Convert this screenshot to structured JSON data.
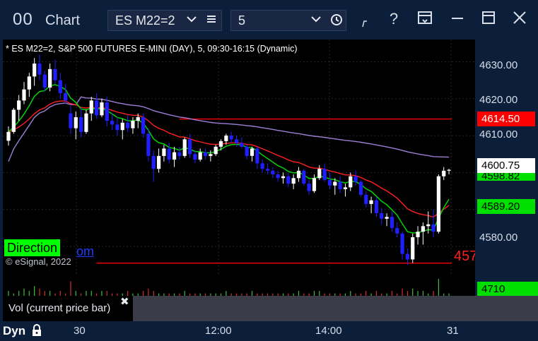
{
  "window": {
    "title_icon": "00",
    "title": "Chart",
    "symbol": "ES M22=2",
    "interval": "5",
    "icons": [
      "chevron-down-icon",
      "menu-icon",
      "chevron-down-icon",
      "clock-icon",
      "draw-icon",
      "help-icon",
      "save-icon",
      "minimize-icon",
      "maximize-icon",
      "close-icon"
    ]
  },
  "chart": {
    "header": "* ES M22=2, S&P 500 FUTURES E-MINI (DAY), 5, 09:30-16:15 (Dynamic)",
    "direction_label": "Direction",
    "partial_text": "om",
    "copyright": "© eSignal, 2022",
    "level_cut_label": "457",
    "price_ticks": [
      "4630.00",
      "4620.00",
      "4610.00",
      "4580.00"
    ],
    "badges": [
      {
        "text": "4614.50",
        "price": 4614.5,
        "bg": "#ff0000",
        "fg": "#ffffff"
      },
      {
        "text": "4600.75",
        "price": 4600.75,
        "bg": "#ffffff",
        "fg": "#000000"
      },
      {
        "text": "4598.82",
        "price": 4598.3,
        "bg": "#00e000",
        "fg": "#000000"
      },
      {
        "text": "4589.20",
        "price": 4589.2,
        "bg": "#00e000",
        "fg": "#000000"
      }
    ],
    "colors": {
      "up": "#ffffff",
      "down": "#1f1fff",
      "fast_ma": "#00e000",
      "slow_ma": "#ff2020",
      "vwap": "#9c7fd6",
      "level": "#ff0000",
      "grid": "#262626"
    }
  },
  "chart_data": {
    "type": "candlestick",
    "x_ticks": [
      "30",
      "12:00",
      "14:00",
      "31"
    ],
    "ylim": [
      4572,
      4636
    ],
    "levels": [
      4614.5,
      4575.5
    ],
    "ohlc": [
      [
        4608.6,
        4612.5,
        4607.3,
        4611.0
      ],
      [
        4611.0,
        4617.5,
        4610.5,
        4617.0
      ],
      [
        4617.0,
        4621.0,
        4614.0,
        4619.5
      ],
      [
        4619.5,
        4624.5,
        4618.5,
        4622.5
      ],
      [
        4622.5,
        4627.0,
        4620.5,
        4626.0
      ],
      [
        4626.0,
        4631.0,
        4623.5,
        4629.5
      ],
      [
        4629.5,
        4632.0,
        4625.0,
        4626.5
      ],
      [
        4626.5,
        4627.5,
        4622.0,
        4623.0
      ],
      [
        4623.0,
        4629.5,
        4622.0,
        4628.0
      ],
      [
        4628.0,
        4630.5,
        4624.0,
        4625.0
      ],
      [
        4625.0,
        4627.0,
        4620.0,
        4621.5
      ],
      [
        4621.5,
        4624.0,
        4618.5,
        4619.5
      ],
      [
        4616.0,
        4618.0,
        4610.5,
        4612.0
      ],
      [
        4612.0,
        4616.5,
        4609.0,
        4615.0
      ],
      [
        4615.0,
        4617.5,
        4609.5,
        4611.0
      ],
      [
        4611.0,
        4617.0,
        4610.5,
        4616.0
      ],
      [
        4616.0,
        4620.5,
        4614.0,
        4619.5
      ],
      [
        4619.5,
        4621.5,
        4614.5,
        4615.5
      ],
      [
        4615.5,
        4620.0,
        4615.0,
        4619.0
      ],
      [
        4619.0,
        4620.5,
        4612.5,
        4614.0
      ],
      [
        4614.0,
        4616.0,
        4611.5,
        4613.0
      ],
      [
        4613.0,
        4615.0,
        4610.0,
        4611.5
      ],
      [
        4611.5,
        4614.5,
        4609.0,
        4613.5
      ],
      [
        4613.5,
        4615.5,
        4611.0,
        4612.0
      ],
      [
        4612.0,
        4615.0,
        4610.5,
        4614.0
      ],
      [
        4614.0,
        4616.0,
        4612.0,
        4615.0
      ],
      [
        4615.0,
        4616.0,
        4609.5,
        4610.5
      ],
      [
        4610.5,
        4612.0,
        4603.0,
        4604.5
      ],
      [
        4604.5,
        4606.0,
        4597.5,
        4601.0
      ],
      [
        4601.0,
        4606.5,
        4600.0,
        4604.5
      ],
      [
        4604.5,
        4607.5,
        4603.0,
        4606.5
      ],
      [
        4606.5,
        4608.0,
        4602.5,
        4603.5
      ],
      [
        4603.5,
        4607.0,
        4601.5,
        4605.5
      ],
      [
        4605.5,
        4607.0,
        4603.5,
        4604.5
      ],
      [
        4604.5,
        4609.5,
        4604.0,
        4609.0
      ],
      [
        4609.0,
        4610.5,
        4604.0,
        4605.0
      ],
      [
        4605.0,
        4606.0,
        4602.5,
        4603.5
      ],
      [
        4603.5,
        4606.5,
        4603.0,
        4605.5
      ],
      [
        4605.5,
        4606.5,
        4603.5,
        4604.5
      ],
      [
        4604.5,
        4606.0,
        4603.0,
        4605.0
      ],
      [
        4605.0,
        4607.5,
        4604.5,
        4607.0
      ],
      [
        4607.0,
        4609.0,
        4606.0,
        4608.5
      ],
      [
        4608.5,
        4610.5,
        4607.5,
        4610.0
      ],
      [
        4610.0,
        4611.0,
        4608.0,
        4609.0
      ],
      [
        4609.0,
        4610.0,
        4607.0,
        4608.0
      ],
      [
        4608.0,
        4609.5,
        4606.5,
        4607.0
      ],
      [
        4607.0,
        4607.5,
        4603.5,
        4604.5
      ],
      [
        4604.5,
        4607.0,
        4603.0,
        4606.5
      ],
      [
        4606.5,
        4607.0,
        4601.0,
        4602.5
      ],
      [
        4602.5,
        4603.5,
        4600.0,
        4601.0
      ],
      [
        4601.0,
        4602.5,
        4599.5,
        4600.5
      ],
      [
        4600.5,
        4601.5,
        4598.5,
        4599.5
      ],
      [
        4599.5,
        4600.5,
        4597.5,
        4598.5
      ],
      [
        4598.5,
        4600.0,
        4597.0,
        4599.0
      ],
      [
        4599.0,
        4600.0,
        4596.0,
        4597.0
      ],
      [
        4597.0,
        4599.5,
        4595.5,
        4598.5
      ],
      [
        4598.5,
        4601.5,
        4597.5,
        4600.5
      ],
      [
        4600.5,
        4601.0,
        4596.5,
        4597.0
      ],
      [
        4597.0,
        4598.0,
        4594.0,
        4595.0
      ],
      [
        4595.0,
        4599.5,
        4594.5,
        4598.5
      ],
      [
        4598.5,
        4602.0,
        4598.0,
        4601.0
      ],
      [
        4601.0,
        4602.5,
        4597.5,
        4598.0
      ],
      [
        4598.0,
        4600.0,
        4595.5,
        4596.5
      ],
      [
        4596.5,
        4598.5,
        4594.0,
        4597.5
      ],
      [
        4597.5,
        4599.0,
        4594.5,
        4595.5
      ],
      [
        4595.5,
        4597.0,
        4593.5,
        4596.0
      ],
      [
        4596.0,
        4600.0,
        4595.0,
        4599.0
      ],
      [
        4599.0,
        4600.5,
        4596.5,
        4597.5
      ],
      [
        4597.5,
        4598.0,
        4593.5,
        4594.0
      ],
      [
        4594.0,
        4595.0,
        4590.5,
        4591.5
      ],
      [
        4591.5,
        4593.5,
        4589.0,
        4592.5
      ],
      [
        4592.5,
        4593.5,
        4588.0,
        4589.0
      ],
      [
        4589.0,
        4590.5,
        4586.0,
        4587.5
      ],
      [
        4587.5,
        4589.0,
        4585.5,
        4588.0
      ],
      [
        4588.0,
        4589.5,
        4584.0,
        4585.0
      ],
      [
        4585.0,
        4586.5,
        4582.5,
        4583.5
      ],
      [
        4583.5,
        4584.0,
        4576.5,
        4578.0
      ],
      [
        4578.0,
        4579.5,
        4575.0,
        4576.5
      ],
      [
        4576.5,
        4583.5,
        4575.5,
        4582.5
      ],
      [
        4582.5,
        4585.5,
        4580.5,
        4584.0
      ],
      [
        4584.0,
        4586.5,
        4580.5,
        4585.5
      ],
      [
        4585.5,
        4589.5,
        4583.5,
        4586.0
      ],
      [
        4586.0,
        4590.0,
        4582.5,
        4584.0
      ],
      [
        4584.0,
        4599.5,
        4583.5,
        4599.0
      ],
      [
        4599.0,
        4601.5,
        4598.0,
        4600.5
      ],
      [
        4600.5,
        4601.0,
        4599.5,
        4600.75
      ]
    ],
    "volume": [
      2,
      1,
      2,
      3,
      2,
      4,
      3,
      2,
      2,
      1,
      2,
      1,
      6,
      2,
      1,
      2,
      2,
      1,
      2,
      2,
      1,
      1,
      1,
      2,
      1,
      1,
      2,
      3,
      2,
      1,
      1,
      1,
      1,
      1,
      2,
      1,
      1,
      1,
      1,
      1,
      1,
      1,
      2,
      1,
      1,
      1,
      1,
      2,
      1,
      1,
      1,
      1,
      1,
      1,
      1,
      1,
      2,
      1,
      1,
      2,
      2,
      1,
      1,
      1,
      1,
      1,
      2,
      1,
      1,
      2,
      1,
      2,
      1,
      1,
      2,
      1,
      3,
      2,
      3,
      2,
      2,
      1,
      2,
      7,
      1,
      1
    ]
  },
  "volume_panel": {
    "tooltip": "Vol (current price bar)",
    "close_icon": "✖",
    "value_label": "4710"
  },
  "footer": {
    "dyn_label": "Dyn",
    "lock_icon": "lock-icon",
    "time_labels": [
      "30",
      "12:00",
      "14:00",
      "31"
    ]
  }
}
